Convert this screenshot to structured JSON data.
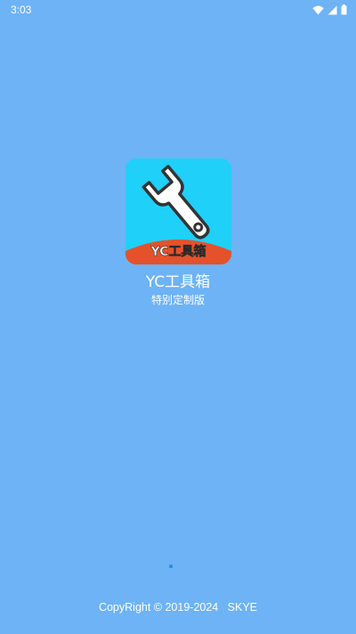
{
  "status_bar": {
    "time": "3:03",
    "icons": [
      "wifi-icon",
      "signal-icon",
      "battery-icon"
    ]
  },
  "splash": {
    "icon_banner_text": "YC工具箱",
    "app_name": "YC工具箱",
    "subtitle": "特别定制版",
    "copyright": "CopyRight © 2019-2024   SKYE"
  },
  "colors": {
    "background": "#6db3f5",
    "icon_background": "#1fd0f8",
    "icon_banner": "#e5512a",
    "loading_dot": "#1e8fe0",
    "text": "#ffffff"
  }
}
